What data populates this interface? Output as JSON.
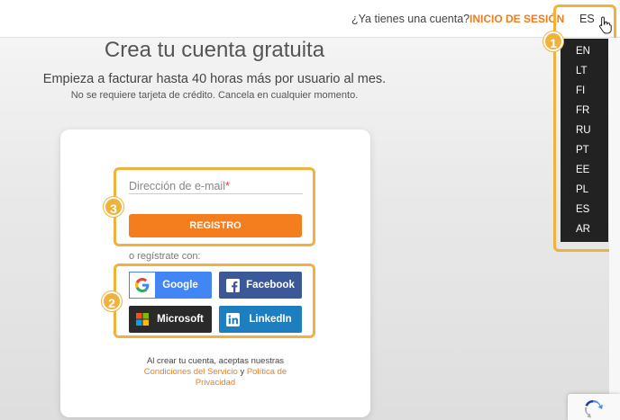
{
  "header": {
    "have_account": "¿Ya tienes una cuenta?",
    "login": "INICIO DE SESIÓN",
    "language": "ES"
  },
  "main": {
    "title": "Crea tu cuenta gratuita",
    "subtitle": "Empieza a facturar hasta 40 horas más por usuario al mes.",
    "subtitle2": "No se requiere tarjeta de crédito. Cancela en cualquier momento."
  },
  "form": {
    "email_placeholder": "Dirección de e-mail",
    "required_mark": "*",
    "register_button": "REGISTRO",
    "or_register_with": "o regístrate con:"
  },
  "social": {
    "google": "Google",
    "facebook": "Facebook",
    "microsoft": "Microsoft",
    "linkedin": "LinkedIn"
  },
  "terms": {
    "prefix": "Al crear tu cuenta, aceptas nuestras",
    "terms_link": "Condiciones del Servicio",
    "and": "y",
    "privacy_link_1": "Política de",
    "privacy_link_2": "Privacidad"
  },
  "language_menu": [
    "EN",
    "LT",
    "FI",
    "FR",
    "RU",
    "PT",
    "EE",
    "PL",
    "ES",
    "AR"
  ],
  "annotations": {
    "badge_1": "1",
    "badge_2": "2",
    "badge_3": "3"
  },
  "colors": {
    "accent": "#f47e1e",
    "highlight": "#f0b23c",
    "google": "#4285f4",
    "facebook": "#3b5998",
    "microsoft": "#2a2a2a",
    "linkedin": "#1d7fbf"
  }
}
